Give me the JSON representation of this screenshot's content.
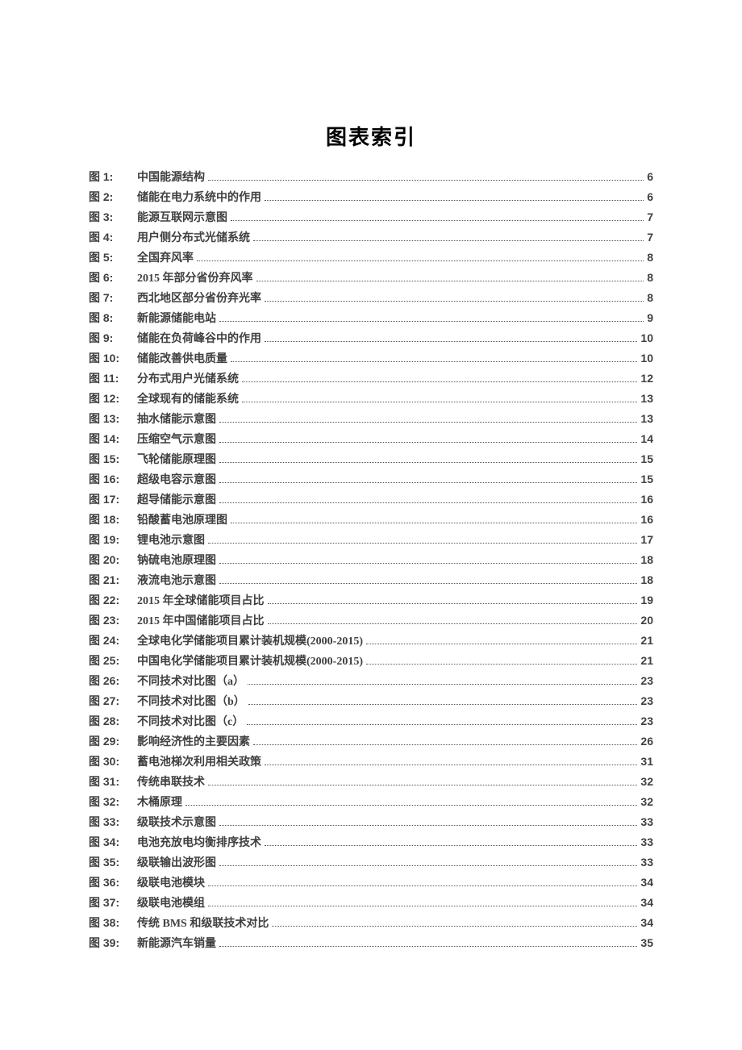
{
  "title": "图表索引",
  "label_prefix": "图",
  "entries": [
    {
      "num": "1",
      "title": "中国能源结构",
      "page": "6"
    },
    {
      "num": "2",
      "title": "储能在电力系统中的作用",
      "page": "6"
    },
    {
      "num": "3",
      "title": "能源互联网示意图",
      "page": "7"
    },
    {
      "num": "4",
      "title": "用户侧分布式光储系统",
      "page": "7"
    },
    {
      "num": "5",
      "title": "全国弃风率",
      "page": "8"
    },
    {
      "num": "6",
      "title": "2015 年部分省份弃风率",
      "page": "8"
    },
    {
      "num": "7",
      "title": "西北地区部分省份弃光率",
      "page": "8"
    },
    {
      "num": "8",
      "title": "新能源储能电站",
      "page": "9"
    },
    {
      "num": "9",
      "title": "储能在负荷峰谷中的作用",
      "page": "10"
    },
    {
      "num": "10",
      "title": "储能改善供电质量",
      "page": "10"
    },
    {
      "num": "11",
      "title": "分布式用户光储系统",
      "page": "12"
    },
    {
      "num": "12",
      "title": "全球现有的储能系统",
      "page": "13"
    },
    {
      "num": "13",
      "title": "抽水储能示意图",
      "page": "13"
    },
    {
      "num": "14",
      "title": "压缩空气示意图",
      "page": "14"
    },
    {
      "num": "15",
      "title": "飞轮储能原理图",
      "page": "15"
    },
    {
      "num": "16",
      "title": "超级电容示意图",
      "page": "15"
    },
    {
      "num": "17",
      "title": "超导储能示意图",
      "page": "16"
    },
    {
      "num": "18",
      "title": "铅酸蓄电池原理图",
      "page": "16"
    },
    {
      "num": "19",
      "title": "锂电池示意图",
      "page": "17"
    },
    {
      "num": "20",
      "title": "钠硫电池原理图",
      "page": "18"
    },
    {
      "num": "21",
      "title": "液流电池示意图",
      "page": "18"
    },
    {
      "num": "22",
      "title": "2015 年全球储能项目占比",
      "page": "19"
    },
    {
      "num": "23",
      "title": "2015 年中国储能项目占比",
      "page": "20"
    },
    {
      "num": "24",
      "title": "全球电化学储能项目累计装机规模(2000-2015)",
      "page": "21"
    },
    {
      "num": "25",
      "title": "中国电化学储能项目累计装机规模(2000-2015)",
      "page": "21"
    },
    {
      "num": "26",
      "title": "不同技术对比图（a）",
      "page": "23"
    },
    {
      "num": "27",
      "title": "不同技术对比图（b）",
      "page": "23"
    },
    {
      "num": "28",
      "title": "不同技术对比图（c）",
      "page": "23"
    },
    {
      "num": "29",
      "title": "影响经济性的主要因素",
      "page": "26"
    },
    {
      "num": "30",
      "title": "蓄电池梯次利用相关政策",
      "page": "31"
    },
    {
      "num": "31",
      "title": "传统串联技术",
      "page": "32"
    },
    {
      "num": "32",
      "title": "木桶原理",
      "page": "32"
    },
    {
      "num": "33",
      "title": "级联技术示意图",
      "page": "33"
    },
    {
      "num": "34",
      "title": "电池充放电均衡排序技术",
      "page": "33"
    },
    {
      "num": "35",
      "title": "级联输出波形图",
      "page": "33"
    },
    {
      "num": "36",
      "title": "级联电池模块",
      "page": "34"
    },
    {
      "num": "37",
      "title": "级联电池模组",
      "page": "34"
    },
    {
      "num": "38",
      "title": "传统 BMS 和级联技术对比",
      "page": "34"
    },
    {
      "num": "39",
      "title": "新能源汽车销量",
      "page": "35"
    }
  ]
}
